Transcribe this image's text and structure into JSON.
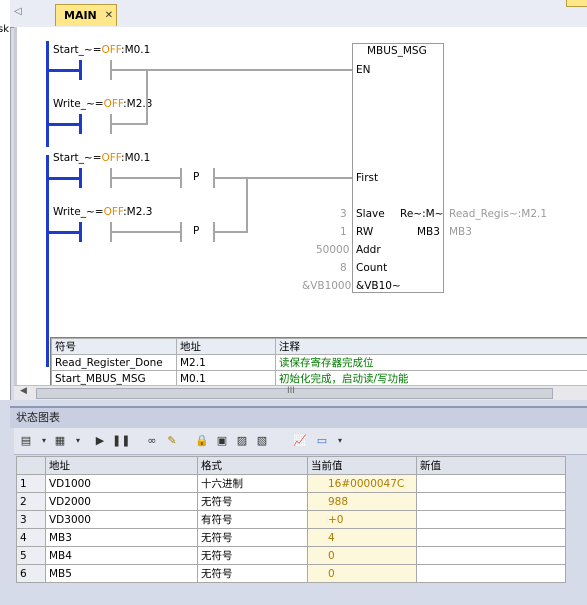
{
  "left_strip_text": "sk",
  "tab": {
    "label": "MAIN",
    "close": "✕"
  },
  "ladder": {
    "network1": {
      "contact1": "Start_~=OFF:M0.1",
      "contact2": "Write_~=OFF:M2.3",
      "block": {
        "name": "MBUS_MSG",
        "en": "EN"
      }
    },
    "network2": {
      "contact1": "Start_~=OFF:M0.1",
      "contact2": "Write_~=OFF:M2.3",
      "p1": "P",
      "p2": "P",
      "pins": {
        "first": "First",
        "slave": "Slave",
        "slave_val": "3",
        "rw": "RW",
        "rw_val": "1",
        "addr": "Addr",
        "addr_val": "50000",
        "count": "Count",
        "count_val": "8",
        "dataptr": "&VB10~",
        "dataptr_val": "&VB1000",
        "done": "Re~:M~",
        "done_out": "Read_Regis~:M2.1",
        "error": "MB3",
        "error_out": "MB3"
      }
    }
  },
  "symbol_table": {
    "headers": [
      "符号",
      "地址",
      "注释"
    ],
    "rows": [
      [
        "Read_Register_Done",
        "M2.1",
        "读保存寄存器完成位"
      ],
      [
        "Start_MBUS_MSG",
        "M0.1",
        "初始化完成，启动读/写功能"
      ]
    ]
  },
  "scroll_marker": "III",
  "status_chart": {
    "title": "状态图表",
    "headers": [
      "地址",
      "格式",
      "当前值",
      "新值"
    ],
    "rows": [
      [
        "1",
        "VD1000",
        "十六进制",
        "16#0000047C",
        ""
      ],
      [
        "2",
        "VD2000",
        "无符号",
        "988",
        ""
      ],
      [
        "3",
        "VD3000",
        "有符号",
        "+0",
        ""
      ],
      [
        "4",
        "MB3",
        "无符号",
        "4",
        ""
      ],
      [
        "5",
        "MB4",
        "无符号",
        "0",
        ""
      ],
      [
        "6",
        "MB5",
        "无符号",
        "0",
        ""
      ]
    ]
  },
  "colors": {
    "rail": "#1f3cc8",
    "off": "#e08a00",
    "tab": "#ffe78a",
    "value": "#b07a00"
  }
}
